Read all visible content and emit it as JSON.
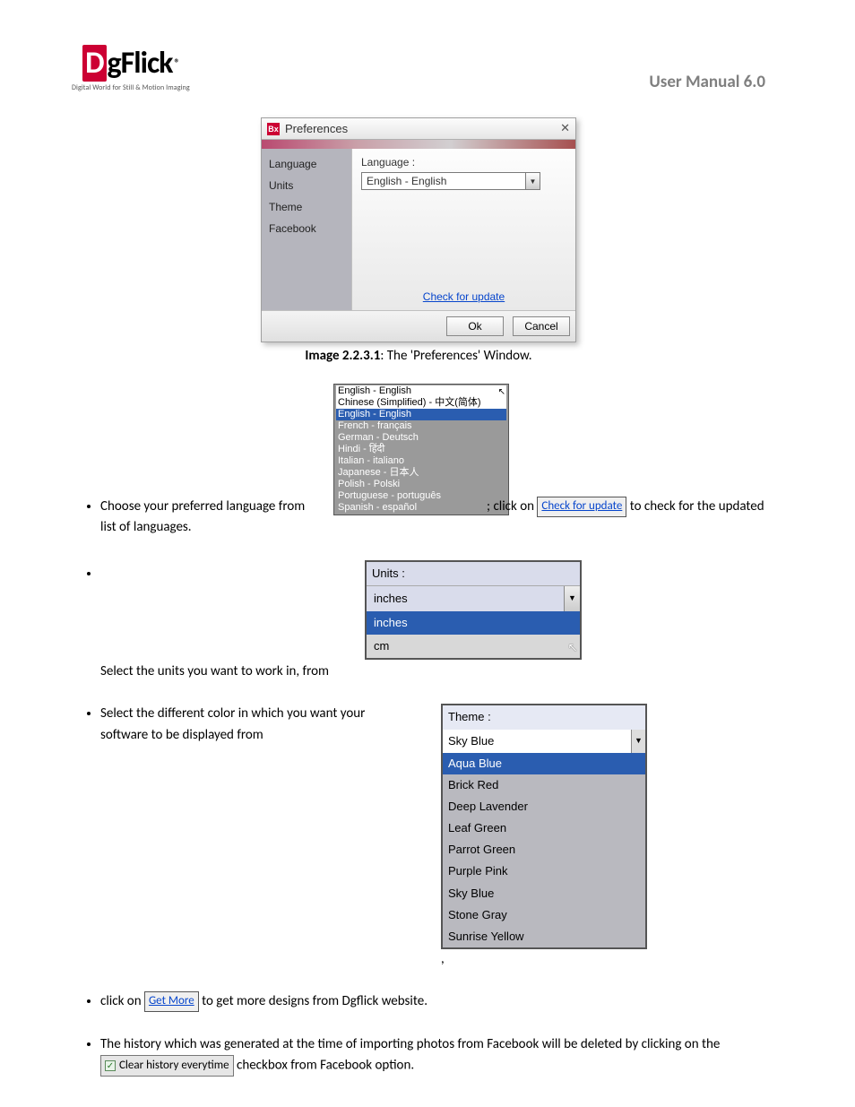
{
  "header": {
    "logo_d": "D",
    "logo_rest": "gFlick",
    "logo_reg": "®",
    "logo_tag": "Digital World for Still & Motion Imaging",
    "manual_title": "User Manual 6.0"
  },
  "pref_window": {
    "title_icon": "Bx",
    "title": "Preferences",
    "side_items": [
      "Language",
      "Units",
      "Theme",
      "Facebook"
    ],
    "lang_label": "Language :",
    "lang_value": "English - English",
    "check_link": "Check for update",
    "ok": "Ok",
    "cancel": "Cancel"
  },
  "caption": {
    "bold": "Image 2.2.3.1",
    "rest": ": The 'Preferences' Window."
  },
  "lang_list": [
    "English - English",
    "Chinese (Simplified) - 中文(简体)",
    "English - English",
    "French - français",
    "German - Deutsch",
    "Hindi - हिंदी",
    "Italian - italiano",
    "Japanese - 日本人",
    "Polish - Polski",
    "Portuguese - português",
    "Spanish - español"
  ],
  "bullets": {
    "b1_pre": "Choose your preferred language from ",
    "b1_mid": "; click on ",
    "b1_link": "Check for update",
    "b1_post": " to check for the updated list of languages.",
    "b2": "Select the units you want to work in, from ",
    "b3": "Select the different color in which you want your software to be displayed from",
    "b4_pre": "click on ",
    "b4_link": "Get More",
    "b4_post": " to get more designs from Dgflick website.",
    "b5_pre": "The history which was generated at the time of importing photos from Facebook will be deleted by clicking on the ",
    "b5_chk": "Clear history everytime",
    "b5_post": " checkbox from Facebook option."
  },
  "units": {
    "label": "Units :",
    "selected": "inches",
    "options": [
      "inches",
      "cm"
    ]
  },
  "theme": {
    "label": "Theme :",
    "selected": "Sky Blue",
    "options": [
      "Aqua Blue",
      "Brick Red",
      "Deep Lavender",
      "Leaf Green",
      "Parrot Green",
      "Purple Pink",
      "Sky Blue",
      "Stone Gray",
      "Sunrise Yellow"
    ]
  },
  "trailing_comma": ","
}
